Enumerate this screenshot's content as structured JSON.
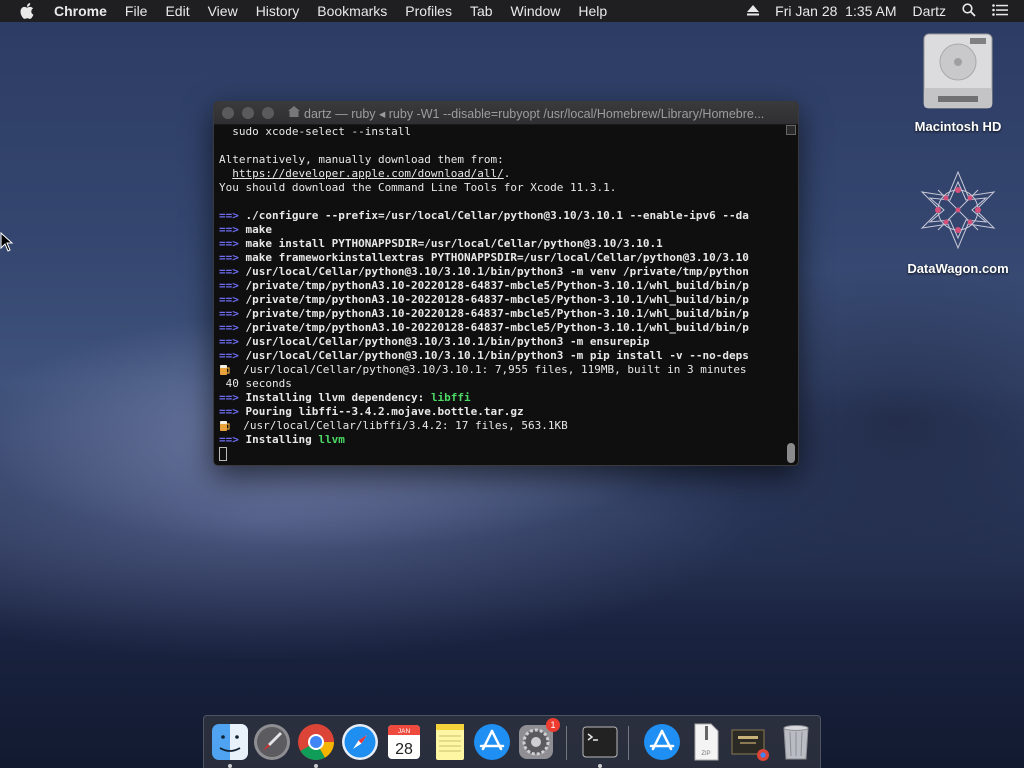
{
  "menubar": {
    "app_name": "Chrome",
    "menus": [
      "File",
      "Edit",
      "View",
      "History",
      "Bookmarks",
      "Profiles",
      "Tab",
      "Window",
      "Help"
    ],
    "clock": "Fri Jan 28  1:35 AM",
    "user": "Dartz"
  },
  "desktop": {
    "icons": [
      {
        "label": "Macintosh HD",
        "icon": "hard-drive-icon"
      },
      {
        "label": "DataWagon.com",
        "icon": "datawagon-icon"
      }
    ]
  },
  "terminal": {
    "title": "dartz — ruby ◂ ruby -W1 --disable=rubyopt /usr/local/Homebrew/Library/Homebre...",
    "lines": [
      {
        "kind": "plain",
        "text": "  sudo xcode-select --install"
      },
      {
        "kind": "blank",
        "text": ""
      },
      {
        "kind": "plain",
        "text": "Alternatively, manually download them from:"
      },
      {
        "kind": "link",
        "prefix": "  ",
        "text": "https://developer.apple.com/download/all/",
        "suffix": "."
      },
      {
        "kind": "plain",
        "text": "You should download the Command Line Tools for Xcode 11.3.1."
      },
      {
        "kind": "blank",
        "text": ""
      },
      {
        "kind": "arrow",
        "text": "./configure --prefix=/usr/local/Cellar/python@3.10/3.10.1 --enable-ipv6 --da"
      },
      {
        "kind": "arrow",
        "text": "make"
      },
      {
        "kind": "arrow",
        "text": "make install PYTHONAPPSDIR=/usr/local/Cellar/python@3.10/3.10.1"
      },
      {
        "kind": "arrow",
        "text": "make frameworkinstallextras PYTHONAPPSDIR=/usr/local/Cellar/python@3.10/3.10"
      },
      {
        "kind": "arrow",
        "text": "/usr/local/Cellar/python@3.10/3.10.1/bin/python3 -m venv /private/tmp/python"
      },
      {
        "kind": "arrow",
        "text": "/private/tmp/pythonA3.10-20220128-64837-mbcle5/Python-3.10.1/whl_build/bin/p"
      },
      {
        "kind": "arrow",
        "text": "/private/tmp/pythonA3.10-20220128-64837-mbcle5/Python-3.10.1/whl_build/bin/p"
      },
      {
        "kind": "arrow",
        "text": "/private/tmp/pythonA3.10-20220128-64837-mbcle5/Python-3.10.1/whl_build/bin/p"
      },
      {
        "kind": "arrow",
        "text": "/private/tmp/pythonA3.10-20220128-64837-mbcle5/Python-3.10.1/whl_build/bin/p"
      },
      {
        "kind": "arrow",
        "text": "/usr/local/Cellar/python@3.10/3.10.1/bin/python3 -m ensurepip"
      },
      {
        "kind": "arrow",
        "text": "/usr/local/Cellar/python@3.10/3.10.1/bin/python3 -m pip install -v --no-deps"
      },
      {
        "kind": "beer",
        "text": "/usr/local/Cellar/python@3.10/3.10.1: 7,955 files, 119MB, built in 3 minutes"
      },
      {
        "kind": "plain",
        "text": " 40 seconds"
      },
      {
        "kind": "garrow",
        "text": "Installing llvm dependency: ",
        "highlight": "libffi"
      },
      {
        "kind": "arrow",
        "text": "Pouring libffi--3.4.2.mojave.bottle.tar.gz"
      },
      {
        "kind": "beer",
        "text": "/usr/local/Cellar/libffi/3.4.2: 17 files, 563.1KB"
      },
      {
        "kind": "garrow",
        "text": "Installing ",
        "highlight": "llvm"
      },
      {
        "kind": "cursor",
        "text": ""
      }
    ],
    "arrow_glyph": "==>"
  },
  "dock": {
    "items": [
      {
        "name": "Finder",
        "icon": "finder-icon"
      },
      {
        "name": "Launchpad",
        "icon": "launchpad-icon"
      },
      {
        "name": "Google Chrome",
        "icon": "chrome-icon"
      },
      {
        "name": "Safari",
        "icon": "safari-icon"
      },
      {
        "name": "Calendar",
        "icon": "calendar-icon",
        "month": "JAN",
        "day": "28"
      },
      {
        "name": "Notes",
        "icon": "notes-icon"
      },
      {
        "name": "App Store",
        "icon": "app-store-icon"
      },
      {
        "name": "System Preferences",
        "icon": "system-preferences-icon",
        "badge": "1"
      },
      {
        "name": "Terminal",
        "icon": "terminal-icon"
      },
      {
        "name": "Downloads",
        "icon": "downloads-folder-icon"
      },
      {
        "name": "Archive",
        "icon": "zip-archive-icon",
        "label": "ZIP"
      },
      {
        "name": "Chrome Installer",
        "icon": "chrome-installer-icon"
      },
      {
        "name": "Trash",
        "icon": "trash-icon"
      }
    ]
  }
}
